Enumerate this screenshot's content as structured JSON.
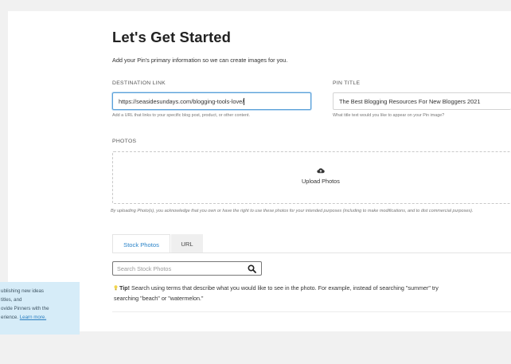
{
  "page": {
    "title": "Let's Get Started",
    "subtitle": "Add your Pin's primary information so we can create images for you."
  },
  "destination_link": {
    "label": "DESTINATION LINK",
    "value": "https://seasidesundays.com/blogging-tools-love/",
    "helper": "Add a URL that links to your specific blog post, product, or other content."
  },
  "pin_title": {
    "label": "PIN TITLE",
    "value": "The Best Blogging Resources For New Bloggers 2021",
    "helper": "What title text would you like to appear on your Pin image?"
  },
  "photos": {
    "label": "PHOTOS",
    "upload_label": "Upload Photos",
    "disclaimer": "By uploading Photo(s), you acknowledge that you own or have the right to use these photos for your intended purposes (including to make modifications, and to dist commercial purposes)."
  },
  "tabs": [
    {
      "label": "Stock Photos",
      "active": true
    },
    {
      "label": "URL",
      "active": false
    }
  ],
  "search": {
    "placeholder": "Search Stock Photos"
  },
  "tip": {
    "bold": "Tip!",
    "text": " Search using terms that describe what you would like to see in the photo. For example, instead of searching \"summer\" try",
    "text2": "searching \"beach\" or \"watermelon.\""
  },
  "sidebar_note": {
    "lines": [
      "ublishing new ideas",
      "titles, and",
      "ovide Pinners with the"
    ],
    "last_line": "erience. ",
    "link": "Learn more."
  },
  "colors": {
    "accent": "#2b84c9",
    "note_bg": "#d6ecf8",
    "page_bg": "#f1f1f1"
  }
}
